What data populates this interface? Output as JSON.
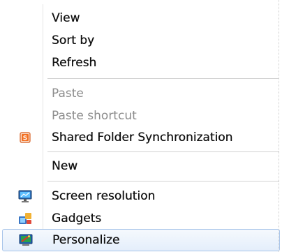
{
  "menu": {
    "items": [
      {
        "label": "View"
      },
      {
        "label": "Sort by"
      },
      {
        "label": "Refresh"
      },
      {
        "label": "Paste"
      },
      {
        "label": "Paste shortcut"
      },
      {
        "label": "Shared Folder Synchronization",
        "icon": "shared-folder-sync-icon"
      },
      {
        "label": "New"
      },
      {
        "label": "Screen resolution",
        "icon": "screen-resolution-icon"
      },
      {
        "label": "Gadgets",
        "icon": "gadgets-icon"
      },
      {
        "label": "Personalize",
        "icon": "personalize-icon"
      }
    ],
    "disabled": [
      "Paste",
      "Paste shortcut"
    ],
    "highlighted": "Personalize"
  },
  "colors": {
    "disabled_text": "#8c8c8c",
    "text": "#111111",
    "highlight_border": "#a9c5ea",
    "icon_orange": "#f36f21"
  }
}
